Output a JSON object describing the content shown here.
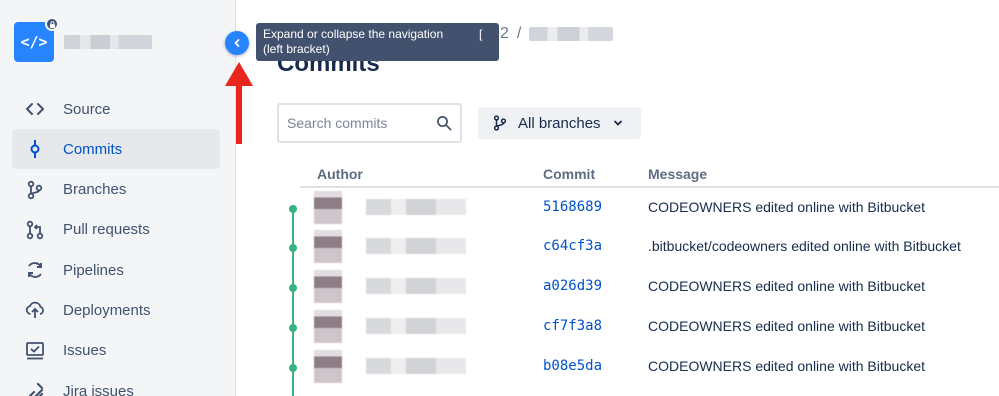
{
  "sidebar": {
    "repo_icon_text": "</>",
    "items": [
      {
        "label": "Source",
        "icon": "code-icon",
        "active": false
      },
      {
        "label": "Commits",
        "icon": "commit-icon",
        "active": true
      },
      {
        "label": "Branches",
        "icon": "branch-icon",
        "active": false
      },
      {
        "label": "Pull requests",
        "icon": "pull-request-icon",
        "active": false
      },
      {
        "label": "Pipelines",
        "icon": "pipelines-icon",
        "active": false
      },
      {
        "label": "Deployments",
        "icon": "deployments-icon",
        "active": false
      },
      {
        "label": "Issues",
        "icon": "issues-icon",
        "active": false
      },
      {
        "label": "Jira issues",
        "icon": "jira-icon",
        "active": false
      }
    ]
  },
  "tooltip": {
    "text_line1": "Expand or collapse the navigation",
    "text_line2": "(left bracket)",
    "shortcut": "["
  },
  "breadcrumb": {
    "partial": "2",
    "separator": "/"
  },
  "page": {
    "title": "Commits"
  },
  "search": {
    "placeholder": "Search commits",
    "value": ""
  },
  "branch_filter": {
    "label": "All branches"
  },
  "table": {
    "headers": {
      "author": "Author",
      "commit": "Commit",
      "message": "Message"
    },
    "rows": [
      {
        "commit": "5168689",
        "message": "CODEOWNERS edited online with Bitbucket"
      },
      {
        "commit": "c64cf3a",
        "message": ".bitbucket/codeowners edited online with Bitbucket"
      },
      {
        "commit": "a026d39",
        "message": "CODEOWNERS edited online with Bitbucket"
      },
      {
        "commit": "cf7f3a8",
        "message": "CODEOWNERS edited online with Bitbucket"
      },
      {
        "commit": "b08e5da",
        "message": "CODEOWNERS edited online with Bitbucket"
      }
    ]
  },
  "colors": {
    "accent": "#2684ff",
    "link": "#0052cc",
    "graph": "#36b37e",
    "annotation_arrow": "#e8261d",
    "tooltip_bg": "#42526e"
  }
}
